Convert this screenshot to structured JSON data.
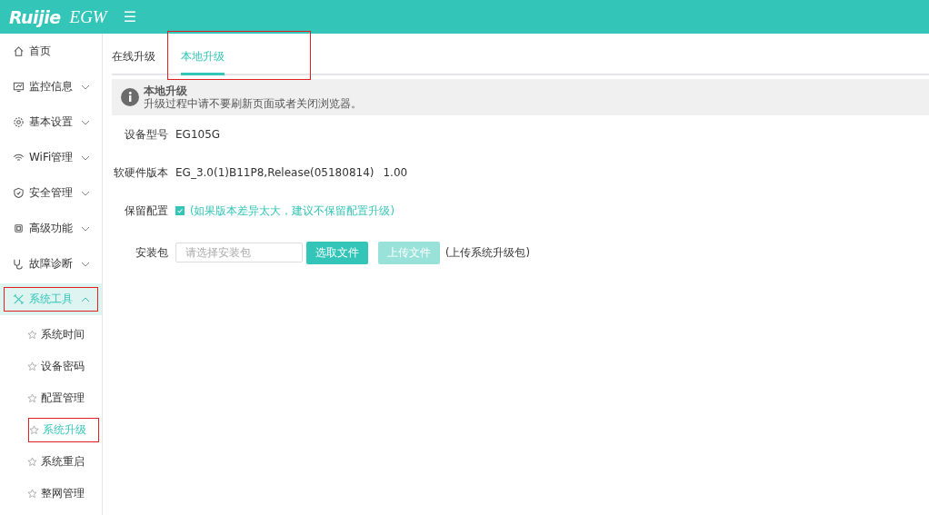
{
  "header": {
    "logo": "Ruijie",
    "product": "EGW",
    "menu_toggle": "☰"
  },
  "sidebar": {
    "items": [
      {
        "kind": "link",
        "label": "首页",
        "selected": false,
        "annotated": false
      },
      {
        "kind": "group",
        "label": "监控信息",
        "expanded": false,
        "selected": false,
        "annotated": false
      },
      {
        "kind": "group",
        "label": "基本设置",
        "expanded": false,
        "selected": false,
        "annotated": false
      },
      {
        "kind": "group",
        "label": "WiFi管理",
        "expanded": false,
        "selected": false,
        "annotated": false
      },
      {
        "kind": "group",
        "label": "安全管理",
        "expanded": false,
        "selected": false,
        "annotated": false
      },
      {
        "kind": "group",
        "label": "高级功能",
        "expanded": false,
        "selected": false,
        "annotated": false
      },
      {
        "kind": "group",
        "label": "故障诊断",
        "expanded": false,
        "selected": false,
        "annotated": false
      },
      {
        "kind": "group",
        "label": "系统工具",
        "expanded": true,
        "selected": true,
        "annotated": true,
        "children": [
          {
            "label": "系统时间",
            "selected": false,
            "annotated": false
          },
          {
            "label": "设备密码",
            "selected": false,
            "annotated": false
          },
          {
            "label": "配置管理",
            "selected": false,
            "annotated": false
          },
          {
            "label": "系统升级",
            "selected": true,
            "annotated": true
          },
          {
            "label": "系统重启",
            "selected": false,
            "annotated": false
          },
          {
            "label": "整网管理",
            "selected": false,
            "annotated": false
          }
        ]
      }
    ]
  },
  "tabs": [
    {
      "label": "在线升级",
      "selected": false,
      "annotated": false
    },
    {
      "label": "本地升级",
      "selected": true,
      "annotated": true
    }
  ],
  "notice": {
    "title": "本地升级",
    "text": "升级过程中请不要刷新页面或者关闭浏览器。"
  },
  "form": {
    "rows": [
      {
        "kind": "text",
        "label": "设备型号",
        "value": "EG105G"
      },
      {
        "kind": "text",
        "label": "软硬件版本",
        "value": "EG_3.0(1)B11P8,Release(05180814)",
        "extra": "1.00"
      },
      {
        "kind": "checkbox",
        "label": "保留配置",
        "checked": true,
        "hint": "(如果版本差异太大，建议不保留配置升级)"
      },
      {
        "kind": "file",
        "label": "安装包",
        "placeholder": "请选择安装包",
        "buttons": [
          {
            "label": "选取文件",
            "disabled": false
          },
          {
            "label": "上传文件",
            "disabled": true
          }
        ],
        "hint": "(上传系统升级包)"
      }
    ]
  }
}
